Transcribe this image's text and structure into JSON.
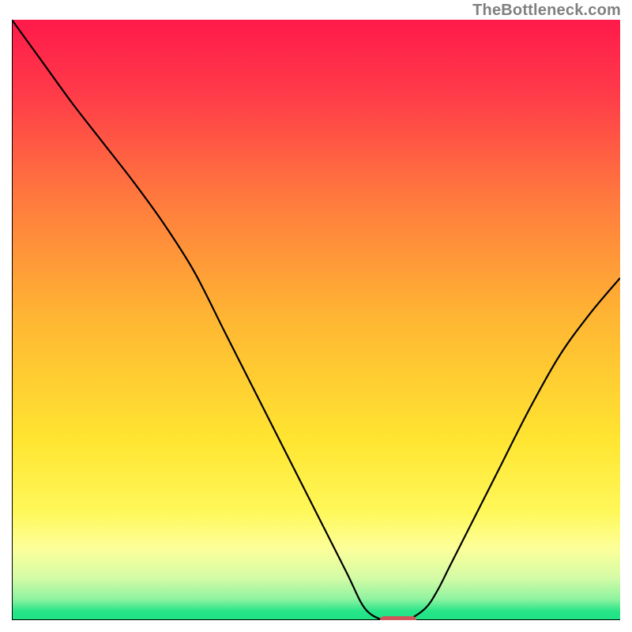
{
  "watermark": "TheBottleneck.com",
  "chart_data": {
    "type": "line",
    "title": "",
    "xlabel": "",
    "ylabel": "",
    "xlim": [
      0,
      100
    ],
    "ylim": [
      0,
      100
    ],
    "grid": false,
    "legend": false,
    "background": {
      "type": "vertical-gradient",
      "stops": [
        {
          "offset": 0.0,
          "color": "#ff1a4a"
        },
        {
          "offset": 0.12,
          "color": "#ff3a49"
        },
        {
          "offset": 0.3,
          "color": "#ff7a3e"
        },
        {
          "offset": 0.5,
          "color": "#ffb733"
        },
        {
          "offset": 0.7,
          "color": "#ffe531"
        },
        {
          "offset": 0.82,
          "color": "#fff85a"
        },
        {
          "offset": 0.88,
          "color": "#fdff99"
        },
        {
          "offset": 0.93,
          "color": "#d4fba6"
        },
        {
          "offset": 0.965,
          "color": "#8ef3a0"
        },
        {
          "offset": 0.985,
          "color": "#28e589"
        },
        {
          "offset": 1.0,
          "color": "#1ee285"
        }
      ]
    },
    "series": [
      {
        "name": "bottleneck-curve",
        "x": [
          0,
          5,
          10,
          15,
          20,
          25,
          30,
          35,
          40,
          45,
          50,
          55,
          58,
          61,
          63,
          65,
          68,
          70,
          72,
          75,
          80,
          85,
          90,
          95,
          100
        ],
        "values": [
          100,
          93,
          86,
          79.5,
          73,
          66,
          58,
          48,
          38,
          28,
          18,
          8,
          2,
          0,
          0,
          0,
          2,
          5,
          9,
          15,
          25,
          35,
          44,
          51,
          57
        ]
      }
    ],
    "marker": {
      "name": "optimal-range",
      "x_start": 60.5,
      "x_end": 66.5,
      "y": 0,
      "color": "#d0555a"
    }
  }
}
